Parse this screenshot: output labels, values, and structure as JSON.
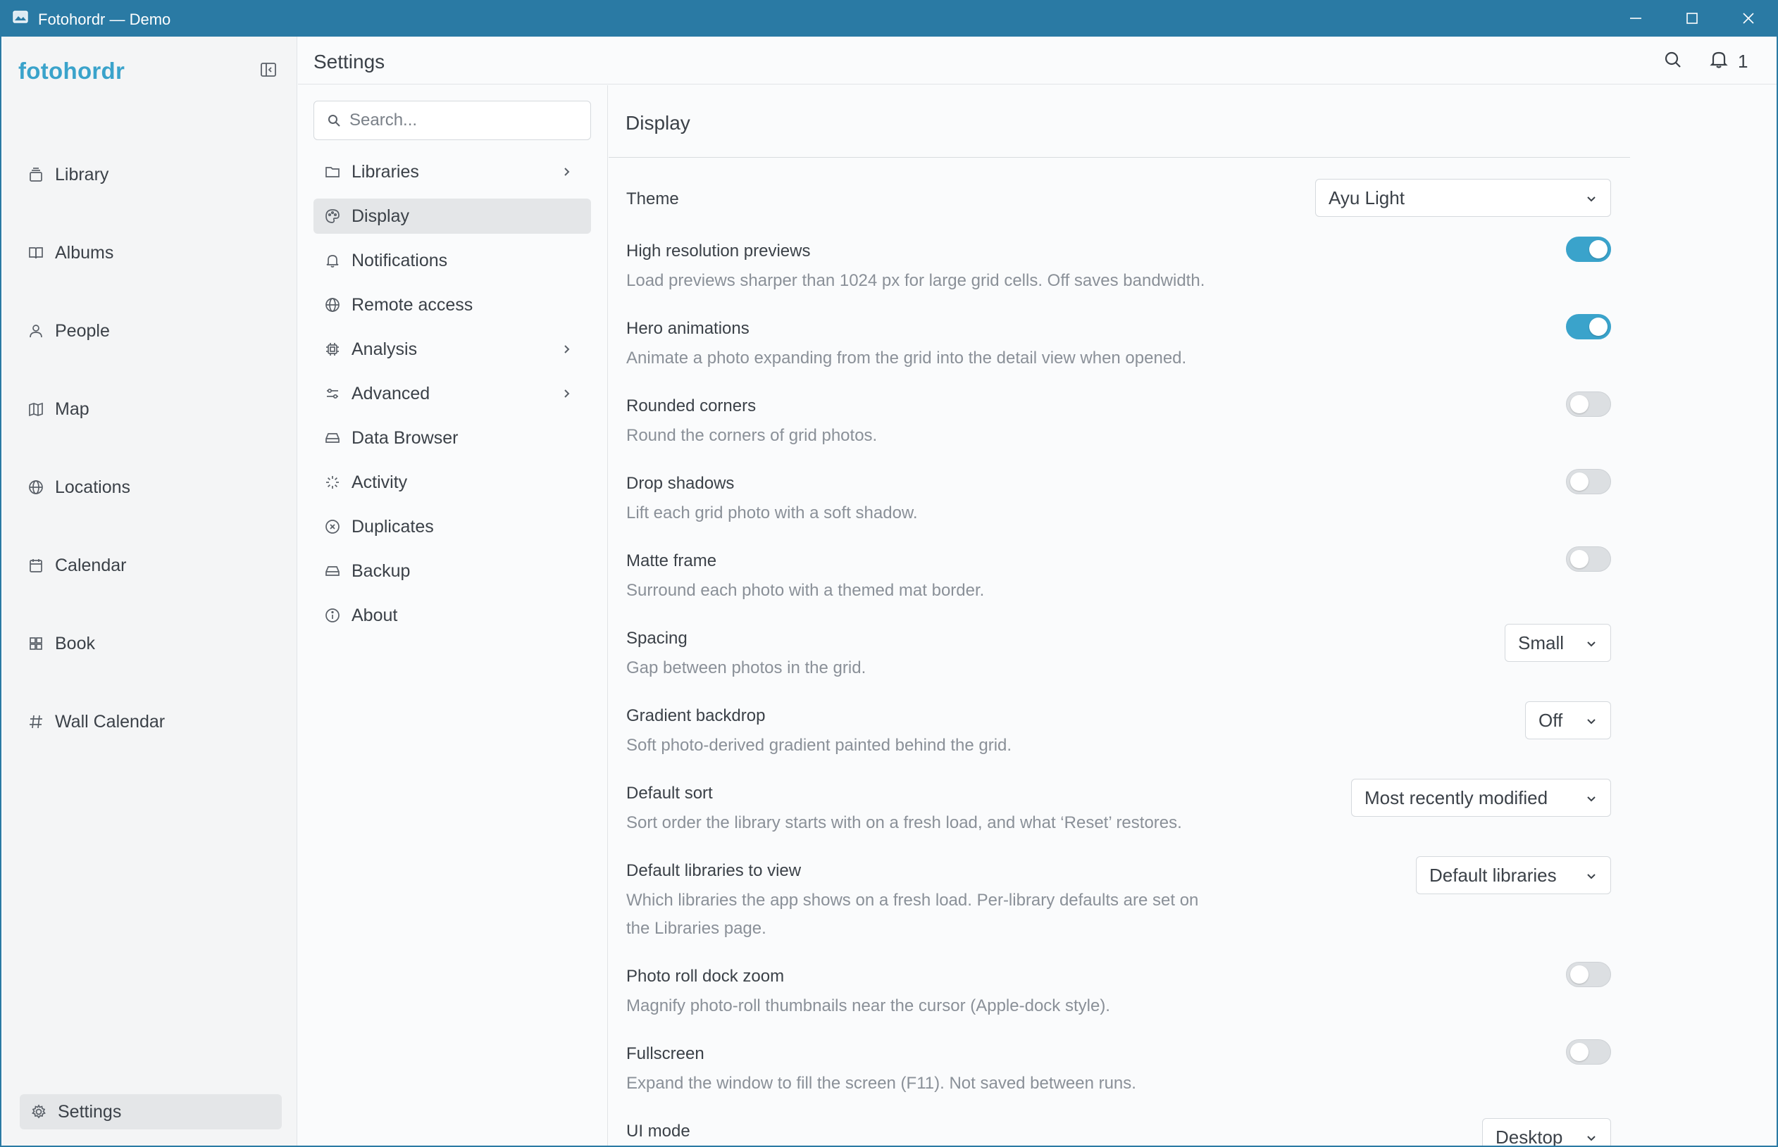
{
  "window": {
    "title": "Fotohordr — Demo",
    "accent": "#2a7aa4"
  },
  "sidebar": {
    "brand": "fotohordr",
    "brand_color": "#3aa3cb",
    "items": [
      {
        "label": "Library",
        "icon": "library-icon"
      },
      {
        "label": "Albums",
        "icon": "book-open-icon"
      },
      {
        "label": "People",
        "icon": "person-icon"
      },
      {
        "label": "Map",
        "icon": "map-icon"
      },
      {
        "label": "Locations",
        "icon": "globe-icon"
      },
      {
        "label": "Calendar",
        "icon": "calendar-icon"
      },
      {
        "label": "Book",
        "icon": "grid-icon"
      },
      {
        "label": "Wall Calendar",
        "icon": "hash-icon"
      }
    ],
    "settings_label": "Settings"
  },
  "header": {
    "title": "Settings",
    "notification_count": "1"
  },
  "menu": {
    "search_placeholder": "Search...",
    "items": [
      {
        "label": "Libraries",
        "icon": "folder-icon",
        "has_submenu": true
      },
      {
        "label": "Display",
        "icon": "palette-icon",
        "active": true
      },
      {
        "label": "Notifications",
        "icon": "bell-icon"
      },
      {
        "label": "Remote access",
        "icon": "globe-icon"
      },
      {
        "label": "Analysis",
        "icon": "chip-icon",
        "has_submenu": true
      },
      {
        "label": "Advanced",
        "icon": "sliders-icon",
        "has_submenu": true
      },
      {
        "label": "Data Browser",
        "icon": "drive-icon"
      },
      {
        "label": "Activity",
        "icon": "loader-icon"
      },
      {
        "label": "Duplicates",
        "icon": "x-circle-icon"
      },
      {
        "label": "Backup",
        "icon": "drive-icon"
      },
      {
        "label": "About",
        "icon": "info-icon"
      }
    ]
  },
  "display": {
    "title": "Display",
    "theme": {
      "label": "Theme",
      "value": "Ayu Light"
    },
    "high_res": {
      "label": "High resolution previews",
      "desc": "Load previews sharper than 1024 px for large grid cells. Off saves bandwidth.",
      "on": true
    },
    "hero": {
      "label": "Hero animations",
      "desc": "Animate a photo expanding from the grid into the detail view when opened.",
      "on": true
    },
    "rounded": {
      "label": "Rounded corners",
      "desc": "Round the corners of grid photos.",
      "on": false
    },
    "shadows": {
      "label": "Drop shadows",
      "desc": "Lift each grid photo with a soft shadow.",
      "on": false
    },
    "matte": {
      "label": "Matte frame",
      "desc": "Surround each photo with a themed mat border.",
      "on": false
    },
    "spacing": {
      "label": "Spacing",
      "desc": "Gap between photos in the grid.",
      "value": "Small"
    },
    "gradient": {
      "label": "Gradient backdrop",
      "desc": "Soft photo-derived gradient painted behind the grid.",
      "value": "Off"
    },
    "sort": {
      "label": "Default sort",
      "desc": "Sort order the library starts with on a fresh load, and what ‘Reset’ restores.",
      "value": "Most recently modified"
    },
    "libraries": {
      "label": "Default libraries to view",
      "desc": "Which libraries the app shows on a fresh load. Per-library defaults are set on the Libraries page.",
      "value": "Default libraries"
    },
    "dock_zoom": {
      "label": "Photo roll dock zoom",
      "desc": "Magnify photo-roll thumbnails near the cursor (Apple-dock style).",
      "on": false
    },
    "fullscreen": {
      "label": "Fullscreen",
      "desc": "Expand the window to fill the screen (F11). Not saved between runs.",
      "on": false
    },
    "ui_mode": {
      "label": "UI mode",
      "value": "Desktop"
    }
  }
}
